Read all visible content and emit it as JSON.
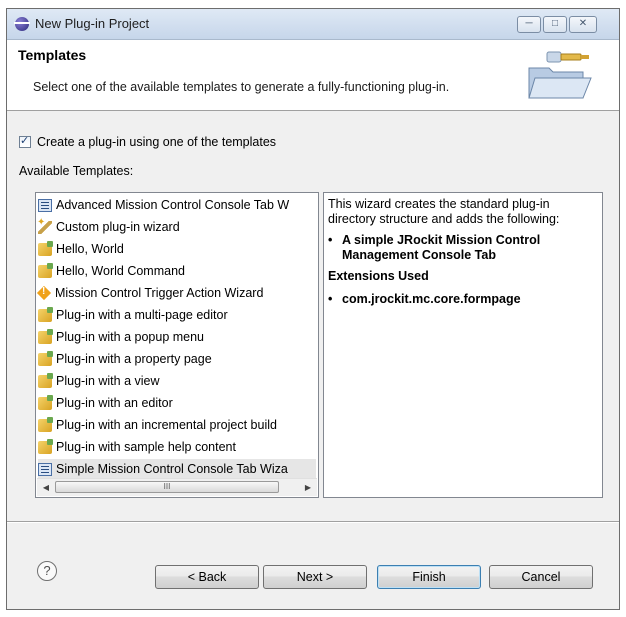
{
  "window": {
    "title": "New Plug-in Project",
    "controls": [
      "minimize",
      "maximize",
      "close"
    ]
  },
  "header": {
    "title": "Templates",
    "description": "Select one of the available templates to generate a fully-functioning plug-in."
  },
  "options": {
    "use_template_label": "Create a plug-in using one of the templates",
    "use_template_checked": true,
    "available_label": "Available Templates:"
  },
  "templates": [
    {
      "label": "Advanced Mission Control Console Tab W",
      "icon": "console-tab-icon"
    },
    {
      "label": "Custom plug-in wizard",
      "icon": "wizard-wand-icon"
    },
    {
      "label": "Hello, World",
      "icon": "plugin-icon"
    },
    {
      "label": "Hello, World Command",
      "icon": "plugin-icon"
    },
    {
      "label": "Mission Control Trigger Action Wizard",
      "icon": "trigger-icon"
    },
    {
      "label": "Plug-in with a multi-page editor",
      "icon": "plugin-icon"
    },
    {
      "label": "Plug-in with a popup menu",
      "icon": "plugin-icon"
    },
    {
      "label": "Plug-in with a property page",
      "icon": "plugin-icon"
    },
    {
      "label": "Plug-in with a view",
      "icon": "plugin-icon"
    },
    {
      "label": "Plug-in with an editor",
      "icon": "plugin-icon"
    },
    {
      "label": "Plug-in with an incremental project build",
      "icon": "plugin-icon"
    },
    {
      "label": "Plug-in with sample help content",
      "icon": "plugin-icon"
    },
    {
      "label": "Simple Mission Control Console Tab Wiza",
      "icon": "console-tab-icon",
      "selected": true
    }
  ],
  "description": {
    "intro": "This wizard creates the standard plug-in directory structure and adds the following:",
    "bullet1": "A simple JRockit Mission Control Management Console Tab",
    "extensions_heading": "Extensions Used",
    "bullet2": "com.jrockit.mc.core.formpage"
  },
  "scrollbar": {
    "thumb_grip": "III"
  },
  "buttons": {
    "help": "?",
    "back": "< Back",
    "next": "Next >",
    "finish": "Finish",
    "cancel": "Cancel"
  }
}
